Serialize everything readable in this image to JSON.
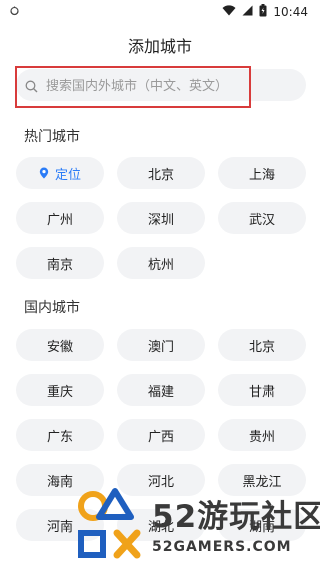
{
  "status_bar": {
    "time": "10:44"
  },
  "header": {
    "title": "添加城市"
  },
  "search": {
    "placeholder": "搜索国内外城市（中文、英文）"
  },
  "hot_section": {
    "title": "热门城市",
    "locate_label": "定位",
    "cities": [
      "北京",
      "上海",
      "广州",
      "深圳",
      "武汉",
      "南京",
      "杭州"
    ]
  },
  "domestic_section": {
    "title": "国内城市",
    "cities": [
      "安徽",
      "澳门",
      "北京",
      "重庆",
      "福建",
      "甘肃",
      "广东",
      "广西",
      "贵州",
      "海南",
      "河北",
      "黑龙江",
      "河南",
      "湖北",
      "湖南"
    ]
  },
  "watermark": {
    "big": "52游玩社区",
    "small": "52GAMERS.COM"
  },
  "colors": {
    "accent": "#2b7cf7",
    "highlight_border": "#d83b3b",
    "chip_bg": "#f2f3f5"
  }
}
